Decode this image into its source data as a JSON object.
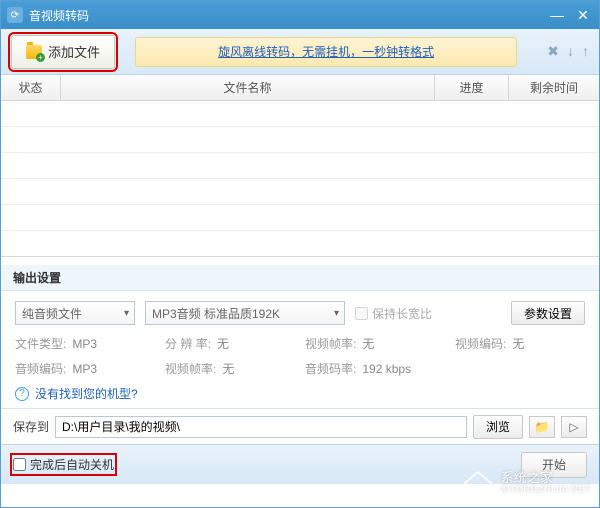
{
  "window": {
    "title": "音视频转码"
  },
  "toolbar": {
    "add_label": "添加文件",
    "promo_text": "旋风离线转码，无需挂机，一秒钟转格式"
  },
  "table": {
    "headers": {
      "status": "状态",
      "name": "文件名称",
      "progress": "进度",
      "remain": "剩余时间"
    }
  },
  "output": {
    "section_title": "输出设置",
    "mode": "纯音频文件",
    "format": "MP3音频 标准品质192K",
    "keep_ratio_label": "保持长宽比",
    "param_button": "参数设置",
    "info": {
      "file_type_label": "文件类型:",
      "file_type": "MP3",
      "resolution_label": "分 辨 率:",
      "resolution": "无",
      "vfps_label": "视频帧率:",
      "vfps": "无",
      "vcodec_label": "视频编码:",
      "vcodec": "无",
      "acodec_label": "音频编码:",
      "acodec": "MP3",
      "afps_label": "视频帧率:",
      "afps": "无",
      "abitrate_label": "音频码率:",
      "abitrate": "192 kbps"
    },
    "help_text": "没有找到您的机型?"
  },
  "save": {
    "label": "保存到",
    "path": "D:\\用户目录\\我的视频\\",
    "browse_label": "浏览"
  },
  "footer": {
    "shutdown_label": "完成后自动关机",
    "start_label": "开始"
  },
  "watermark": {
    "line1": "系统之家",
    "line2": "XITONGZHIJIA.NET"
  }
}
